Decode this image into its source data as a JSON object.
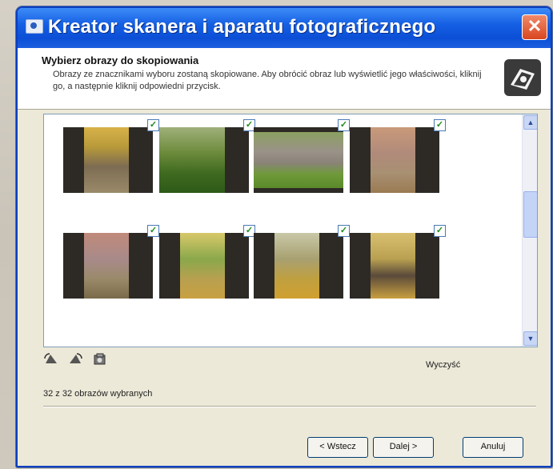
{
  "window": {
    "title": "Kreator skanera i aparatu fotograficznego",
    "close_symbol": "✕"
  },
  "header": {
    "title": "Wybierz obrazy do skopiowania",
    "description": "Obrazy ze znacznikami wyboru zostaną skopiowane. Aby obrócić obraz lub wyświetlić jego właściwości, kliknij go, a następnie kliknij odpowiedni przycisk.",
    "icon": "camera-wizard-icon"
  },
  "gallery": {
    "images": [
      {
        "name": "photo-1",
        "checked": true
      },
      {
        "name": "photo-2",
        "checked": true
      },
      {
        "name": "photo-3",
        "checked": true
      },
      {
        "name": "photo-4",
        "checked": true
      },
      {
        "name": "photo-5",
        "checked": true
      },
      {
        "name": "photo-6",
        "checked": true
      },
      {
        "name": "photo-7",
        "checked": true
      },
      {
        "name": "photo-8",
        "checked": true
      }
    ],
    "check_mark": "✓"
  },
  "tools": {
    "rotate_left_icon": "rotate-left-icon",
    "rotate_right_icon": "rotate-right-icon",
    "properties_icon": "properties-icon"
  },
  "clear_label": "Wyczyść",
  "status": "32 z 32 obrazów wybranych",
  "buttons": {
    "back": "< Wstecz",
    "next": "Dalej >",
    "cancel": "Anuluj"
  },
  "colors": {
    "title_bar": "#0b4fd6",
    "close_button": "#d9461f",
    "dialog_bg": "#ece9d8",
    "check_green": "#1d8a1d"
  }
}
